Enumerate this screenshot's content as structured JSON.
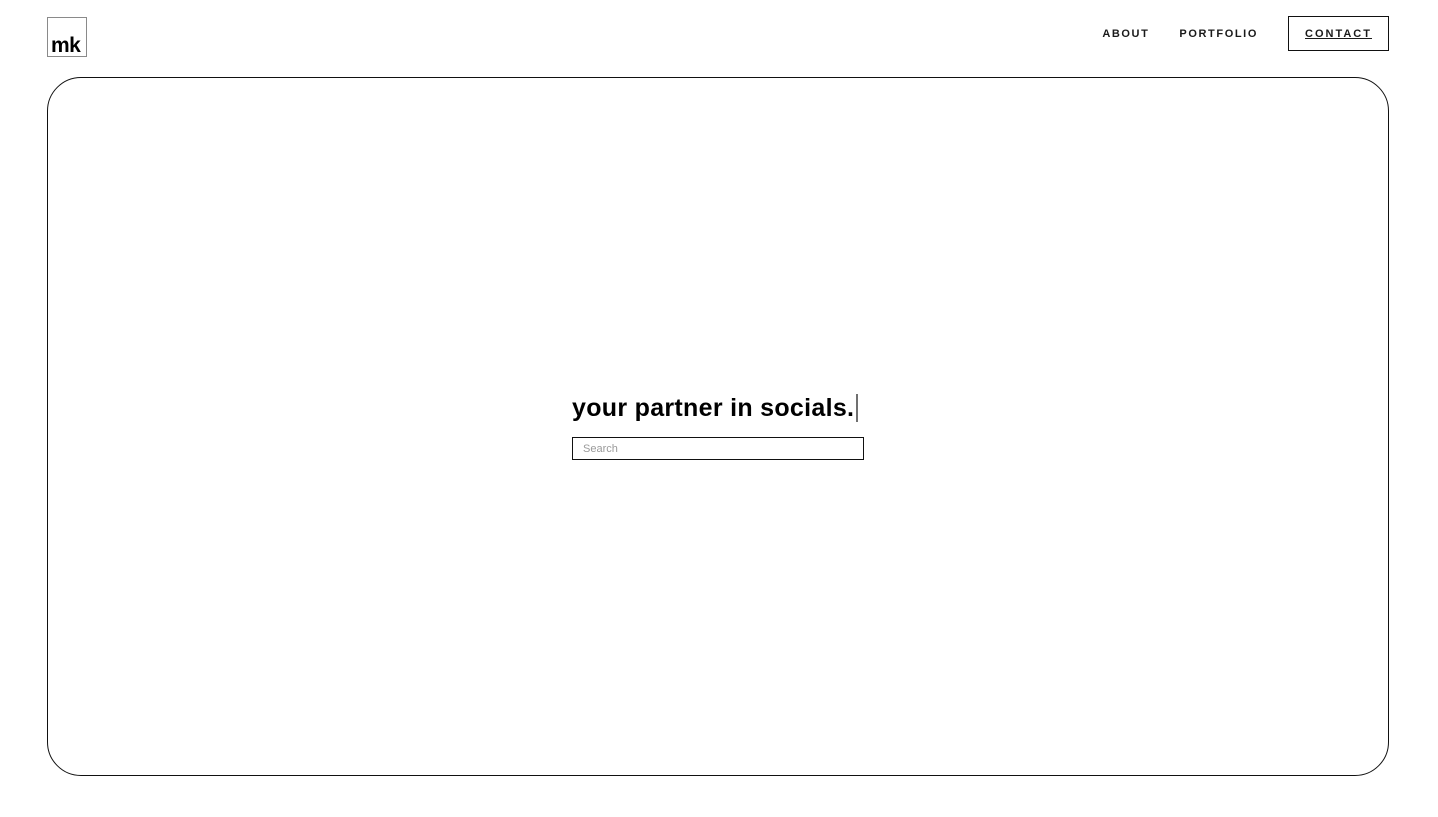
{
  "brand": {
    "logo_text": "mk"
  },
  "nav": {
    "items": [
      {
        "label": "ABOUT"
      },
      {
        "label": "PORTFOLIO"
      }
    ],
    "contact_label": "CONTACT"
  },
  "hero": {
    "tagline": "your partner in socials.",
    "search": {
      "placeholder": "Search",
      "value": ""
    }
  },
  "colors": {
    "background": "#ffffff",
    "text": "#111111",
    "border": "#111111",
    "cursor": "#707070",
    "placeholder": "#9a9a9a"
  }
}
